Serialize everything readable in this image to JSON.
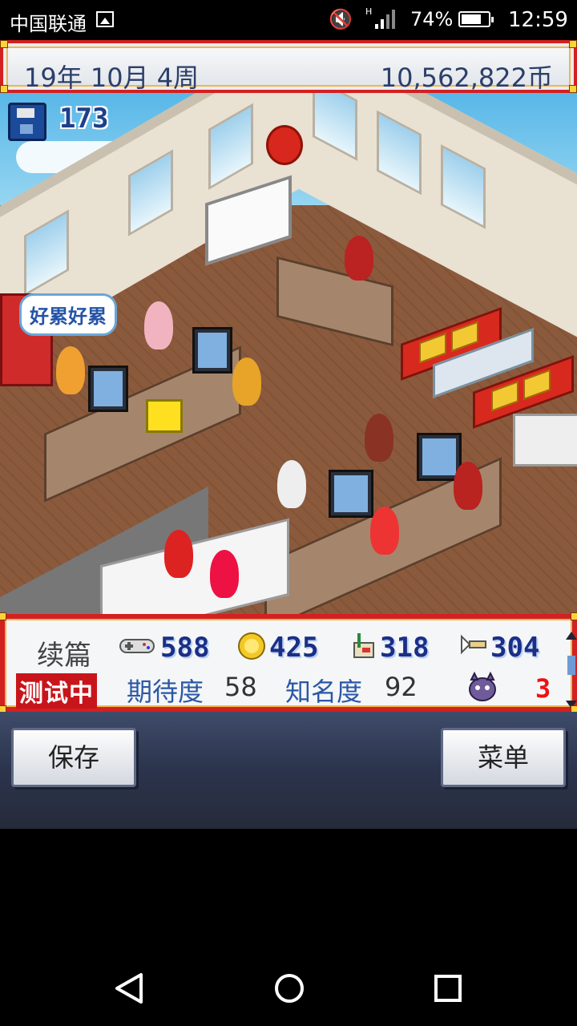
{
  "status_bar": {
    "carrier": "中国联通",
    "battery_percent": "74%",
    "battery_level": 0.74,
    "time": "12:59",
    "icons": [
      "image-icon",
      "mute-icon",
      "signal-icon",
      "battery-icon"
    ]
  },
  "top_bar": {
    "date": "19年 10月 4周",
    "money": "10,562,822币"
  },
  "game": {
    "save_count": "173",
    "speech_bubble": "好累好累"
  },
  "project": {
    "title": "续篇",
    "status": "测试中",
    "stats": [
      {
        "icon": "gamepad-icon",
        "value": "588"
      },
      {
        "icon": "coin-icon",
        "value": "425"
      },
      {
        "icon": "paint-icon",
        "value": "318"
      },
      {
        "icon": "sound-icon",
        "value": "304"
      }
    ],
    "expectation_label": "期待度",
    "expectation_value": "58",
    "fame_label": "知名度",
    "fame_value": "92",
    "bug_icon": "bug-monster-icon",
    "bug_count": "3"
  },
  "buttons": {
    "save": "保存",
    "menu": "菜单"
  },
  "nav": [
    "back-icon",
    "home-icon",
    "recents-icon"
  ]
}
